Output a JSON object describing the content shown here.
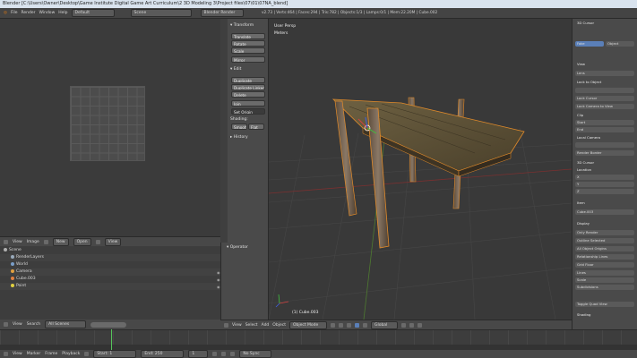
{
  "window_title": "Blender [C:\\Users\\Owner\\Desktop\\Game Institute Digital Game Art Curriculum\\2 3D Modeling 3\\Project files\\07\\01\\07NA_blend]",
  "menubar": {
    "menus": [
      "File",
      "Render",
      "Window",
      "Help"
    ],
    "layout": "Default",
    "scene": "Scene",
    "engine": "Blender Render",
    "stats": "v2.73 | Verts:464 | Faces:294 | Tris:782 | Objects:1/3 | Lamps:0/1 | Mem:22.20M | Cube.002"
  },
  "uv_header": {
    "items": [
      "View",
      "Image"
    ],
    "new_label": "New",
    "open_label": "Open",
    "view_label": "View"
  },
  "outliner": {
    "rows": [
      "Scene",
      "RenderLayers",
      "World",
      "Camera",
      "Cube.003",
      "Point"
    ]
  },
  "outliner_header": {
    "items": [
      "View",
      "Search"
    ],
    "filter": "All Scenes"
  },
  "toolshelf": {
    "transform_header": "Transform",
    "transform_buttons": [
      "Translate",
      "Rotate",
      "Scale",
      "Mirror"
    ],
    "edit_header": "Edit",
    "edit_buttons": [
      "Duplicate",
      "Duplicate Linked",
      "Delete",
      "Join"
    ],
    "set_origin": "Set Origin",
    "shading_label": "Shading:",
    "smooth": "Smooth",
    "flat": "Flat",
    "history_header": "History",
    "operator_header": "Operator"
  },
  "viewport": {
    "view_label": "User Persp",
    "units_label": "Meters",
    "object_label": "(1) Cube.003"
  },
  "viewport_header": {
    "items": [
      "View",
      "Select",
      "Add",
      "Object"
    ],
    "mode": "Object Mode",
    "pivot": "Global"
  },
  "properties": {
    "panel_top": "3D Cursor",
    "item_buttons": [
      "Fake",
      "Object"
    ],
    "lines": [
      "View",
      "Lens",
      "Lock to Object",
      "Lock Cursor",
      "Lock Camera to View",
      "Clip",
      "Start",
      "End",
      "Local Camera",
      "Render Border",
      "3D Cursor",
      "Location",
      "X",
      "Y",
      "Z",
      "Item",
      "Cube.003",
      "Display",
      "Only Render",
      "Outline Selected",
      "All Object Origins",
      "Relationship Lines",
      "Grid Floor",
      "Lines",
      "Scale",
      "Subdivisions",
      "Toggle Quad View",
      "Shading"
    ],
    "colors": {
      "selected_button": "#5a7fb8"
    }
  },
  "timeline_header": {
    "items": [
      "View",
      "Marker",
      "Frame",
      "Playback"
    ],
    "start": "Start:",
    "start_value": "1",
    "end": "End:",
    "end_value": "250",
    "current": "1",
    "sync": "No Sync"
  }
}
